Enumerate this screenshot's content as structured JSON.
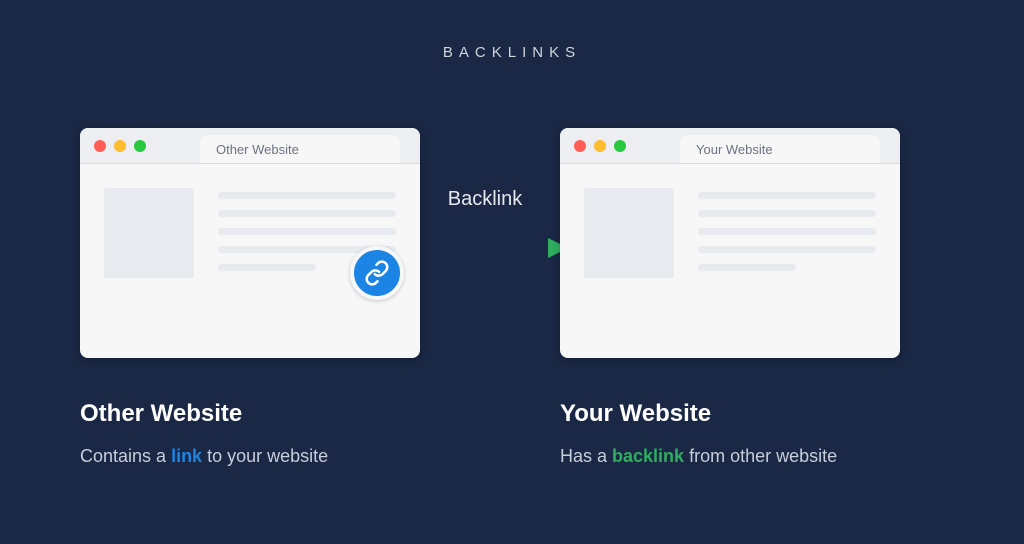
{
  "title": "BACKLINKS",
  "arrow_label": "Backlink",
  "left": {
    "tab_label": "Other Website",
    "heading": "Other Website",
    "caption_pre": "Contains a ",
    "caption_highlight": "link",
    "caption_post": " to your website"
  },
  "right": {
    "tab_label": "Your Website",
    "heading": "Your Website",
    "caption_pre": "Has a ",
    "caption_highlight": "backlink",
    "caption_post": " from other website"
  },
  "colors": {
    "background": "#1a2845",
    "accent_blue": "#1c84e4",
    "accent_green": "#2fae60"
  }
}
